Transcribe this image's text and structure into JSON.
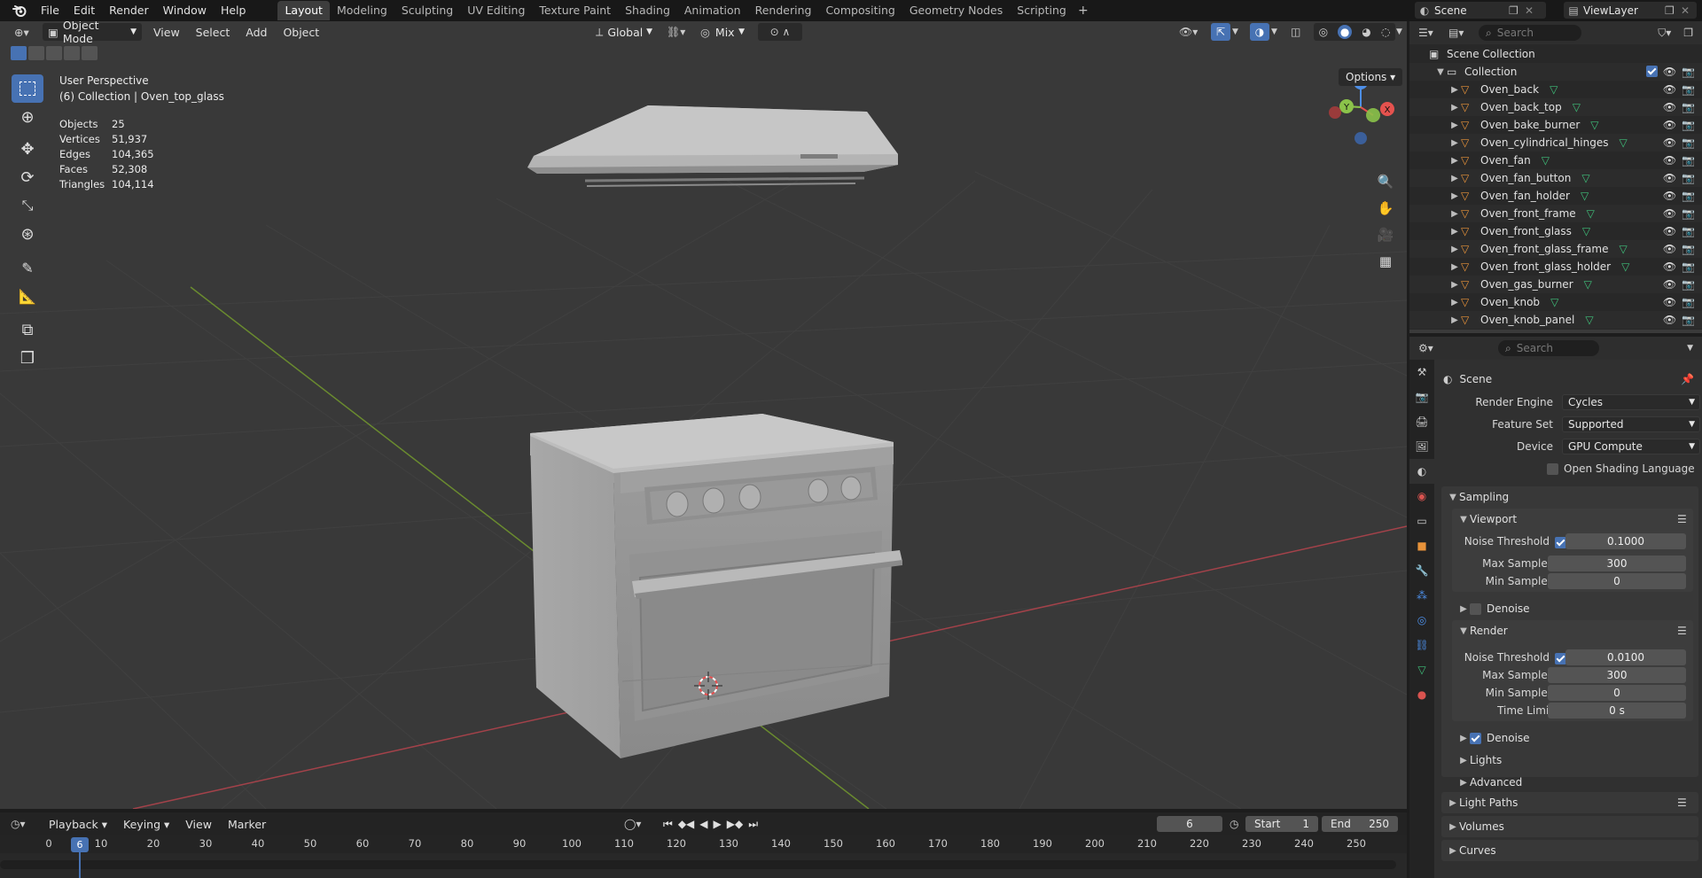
{
  "topbar": {
    "menus": [
      "File",
      "Edit",
      "Render",
      "Window",
      "Help"
    ],
    "workspaces": [
      "Layout",
      "Modeling",
      "Sculpting",
      "UV Editing",
      "Texture Paint",
      "Shading",
      "Animation",
      "Rendering",
      "Compositing",
      "Geometry Nodes",
      "Scripting"
    ],
    "add_symbol": "+",
    "scene_name": "Scene",
    "view_layer": "ViewLayer"
  },
  "viewport": {
    "mode": "Object Mode",
    "menus": [
      "View",
      "Select",
      "Add",
      "Object"
    ],
    "orientation": "Global",
    "pivot": "Mix",
    "options_label": "Options",
    "perspective": "User Perspective",
    "active_info": "(6) Collection | Oven_top_glass",
    "stats": [
      {
        "key": "Objects",
        "value": "25"
      },
      {
        "key": "Vertices",
        "value": "51,937"
      },
      {
        "key": "Edges",
        "value": "104,365"
      },
      {
        "key": "Faces",
        "value": "52,308"
      },
      {
        "key": "Triangles",
        "value": "104,114"
      }
    ],
    "gizmo": {
      "z": "Z",
      "y": "Y",
      "x": "X"
    }
  },
  "timeline": {
    "menus": [
      "Playback",
      "Keying",
      "View",
      "Marker"
    ],
    "current_frame": "6",
    "start_label": "Start",
    "start_value": "1",
    "end_label": "End",
    "end_value": "250",
    "ticks": [
      "0",
      "10",
      "20",
      "30",
      "40",
      "50",
      "60",
      "70",
      "80",
      "90",
      "100",
      "110",
      "120",
      "130",
      "140",
      "150",
      "160",
      "170",
      "180",
      "190",
      "200",
      "210",
      "220",
      "230",
      "240",
      "250"
    ],
    "playhead_label": "6"
  },
  "outliner": {
    "search_placeholder": "Search",
    "scene_collection": "Scene Collection",
    "collection": "Collection",
    "objects": [
      "Oven_back",
      "Oven_back_top",
      "Oven_bake_burner",
      "Oven_cylindrical_hinges",
      "Oven_fan",
      "Oven_fan_button",
      "Oven_fan_holder",
      "Oven_front_frame",
      "Oven_front_glass",
      "Oven_front_glass_frame",
      "Oven_front_glass_holder",
      "Oven_gas_burner",
      "Oven_knob",
      "Oven_knob_panel"
    ]
  },
  "properties": {
    "search_placeholder": "Search",
    "context": "Scene",
    "render_engine_label": "Render Engine",
    "render_engine": "Cycles",
    "feature_set_label": "Feature Set",
    "feature_set": "Supported",
    "device_label": "Device",
    "device": "GPU Compute",
    "osl_label": "Open Shading Language",
    "sampling": "Sampling",
    "viewport": {
      "title": "Viewport",
      "noise_threshold_label": "Noise Threshold",
      "noise_threshold": "0.1000",
      "max_samples_label": "Max Samples",
      "max_samples": "300",
      "min_samples_label": "Min Samples",
      "min_samples": "0",
      "denoise": "Denoise"
    },
    "render": {
      "title": "Render",
      "noise_threshold_label": "Noise Threshold",
      "noise_threshold": "0.0100",
      "max_samples_label": "Max Samples",
      "max_samples": "300",
      "min_samples_label": "Min Samples",
      "min_samples": "0",
      "time_limit_label": "Time Limit",
      "time_limit": "0 s",
      "denoise": "Denoise"
    },
    "lights": "Lights",
    "advanced": "Advanced",
    "light_paths": "Light Paths",
    "volumes": "Volumes",
    "curves": "Curves"
  },
  "colors": {
    "accent": "#4772b3",
    "x_axis": "#e5524e",
    "y_axis": "#8bc34a",
    "z_axis": "#4d8fe8",
    "object_icon": "#e8933a",
    "mesh_icon": "#3fc07a"
  }
}
